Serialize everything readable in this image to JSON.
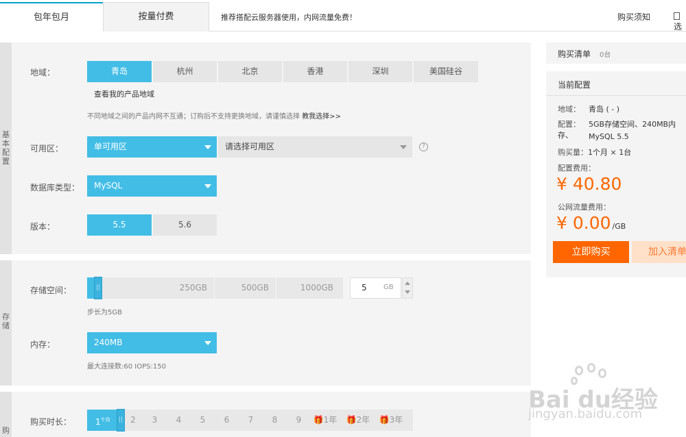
{
  "tabs": {
    "annual": "包年包月",
    "payg": "按量付费"
  },
  "promo": "推荐搭配云服务器使用，内网流量免费！",
  "top_links": {
    "notice": "购买须知",
    "more": "选"
  },
  "basic": {
    "side": "基本配置",
    "region": {
      "label": "地域：",
      "options": [
        "青岛",
        "杭州",
        "北京",
        "香港",
        "深圳",
        "美国硅谷"
      ],
      "selected": "青岛",
      "link": "查看我的产品地域",
      "note": "不同地域之间的产品内网不互通；订购后不支持更换地域，请谨慎选择",
      "note_link": "教我选择>>"
    },
    "zone": {
      "label": "可用区：",
      "value": "单可用区",
      "placeholder": "请选择可用区"
    },
    "db": {
      "label": "数据库类型：",
      "value": "MySQL"
    },
    "version": {
      "label": "版本：",
      "options": [
        "5.5",
        "5.6"
      ],
      "selected": "5.5"
    }
  },
  "storage": {
    "side": "存储",
    "space": {
      "label": "存储空间：",
      "ticks": [
        "250GB",
        "500GB",
        "1000GB"
      ],
      "value": "5",
      "unit": "GB",
      "note": "步长为5GB"
    },
    "memory": {
      "label": "内存：",
      "value": "240MB",
      "note": "最大连接数:60 IOPS:150"
    }
  },
  "purchase": {
    "side": "购",
    "duration": {
      "label": "购买时长：",
      "first": "1",
      "first_unit": "个月",
      "months": [
        "2",
        "3",
        "4",
        "5",
        "6",
        "7",
        "8",
        "9"
      ],
      "years": [
        "1年",
        "2年",
        "3年"
      ]
    }
  },
  "cart": {
    "title": "购买清单",
    "count": "0台"
  },
  "config": {
    "title": "当前配置",
    "region_label": "地域：",
    "region_value": "青岛 ( - )",
    "conf_label": "配置：",
    "conf_value1": "5GB存储空间、240MB内存、",
    "conf_value2": "MySQL 5.5",
    "qty_label": "购买量：",
    "qty_value": "1个月 × 1台",
    "fee_label": "配置费用：",
    "fee": "¥ 40.80",
    "traffic_label": "公网流量费用：",
    "traffic_fee": "¥ 0.00",
    "traffic_unit": "/GB",
    "buy_now": "立即购买",
    "add_cart": "加入清单"
  },
  "watermark": {
    "brand": "Bai  du经验",
    "url": "jingyan.baidu.com"
  },
  "colors": {
    "accent": "#42bde6",
    "price": "#ff6600",
    "buy": "#ff6600"
  }
}
